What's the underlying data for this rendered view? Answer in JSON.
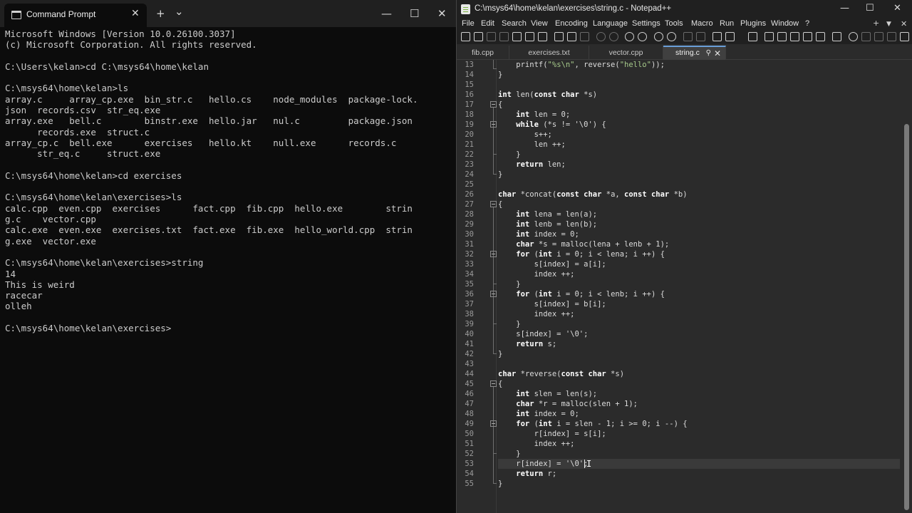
{
  "cmd": {
    "tab_title": "Command Prompt",
    "tab_close": "✕",
    "new_tab": "+",
    "dropdown": "⌄",
    "minimize": "—",
    "maximize": "☐",
    "close": "✕",
    "output": "Microsoft Windows [Version 10.0.26100.3037]\n(c) Microsoft Corporation. All rights reserved.\n\nC:\\Users\\kelan>cd C:\\msys64\\home\\kelan\n\nC:\\msys64\\home\\kelan>ls\narray.c     array_cp.exe  bin_str.c   hello.cs    node_modules  package-lock.\njson  records.csv  str_eq.exe\narray.exe   bell.c        binstr.exe  hello.jar   nul.c         package.json\n      records.exe  struct.c\narray_cp.c  bell.exe      exercises   hello.kt    null.exe      records.c\n      str_eq.c     struct.exe\n\nC:\\msys64\\home\\kelan>cd exercises\n\nC:\\msys64\\home\\kelan\\exercises>ls\ncalc.cpp  even.cpp  exercises      fact.cpp  fib.cpp  hello.exe        strin\ng.c    vector.cpp\ncalc.exe  even.exe  exercises.txt  fact.exe  fib.exe  hello_world.cpp  strin\ng.exe  vector.exe\n\nC:\\msys64\\home\\kelan\\exercises>string\n14\nThis is weird\nracecar\nolleh\n\nC:\\msys64\\home\\kelan\\exercises>"
  },
  "npp": {
    "title": "C:\\msys64\\home\\kelan\\exercises\\string.c - Notepad++",
    "window_controls": {
      "minimize": "—",
      "maximize": "☐",
      "close": "✕"
    },
    "menu": [
      "File",
      "Edit",
      "Search",
      "View",
      "Encoding",
      "Language",
      "Settings",
      "Tools",
      "Macro",
      "Run",
      "Plugins",
      "Window",
      "?"
    ],
    "menu_right": {
      "plus": "+",
      "dropdown": "▼",
      "close": "✕"
    },
    "tabs": [
      {
        "label": "fib.cpp"
      },
      {
        "label": "exercises.txt"
      },
      {
        "label": "vector.cpp"
      },
      {
        "label": "string.c",
        "pin": "⚲",
        "close": "✕"
      }
    ],
    "line_numbers": [
      "13",
      "14",
      "15",
      "16",
      "17",
      "18",
      "19",
      "20",
      "21",
      "22",
      "23",
      "24",
      "25",
      "26",
      "27",
      "28",
      "29",
      "30",
      "31",
      "32",
      "33",
      "34",
      "35",
      "36",
      "37",
      "38",
      "39",
      "40",
      "41",
      "42",
      "43",
      "44",
      "45",
      "46",
      "47",
      "48",
      "49",
      "50",
      "51",
      "52",
      "53",
      "54",
      "55"
    ],
    "code": {
      "l13a": "    printf(",
      "l13b": "\"%s\\n\"",
      "l13c": ", reverse(",
      "l13d": "\"hello\"",
      "l13e": "));",
      "l14": "}",
      "l16a": "int",
      "l16b": " len(",
      "l16c": "const char",
      "l16d": " *s)",
      "l17": "{",
      "l18a": "    int",
      "l18b": " len = 0;",
      "l19a": "    while",
      "l19b": " (*s != '\\0') {",
      "l20": "        s++;",
      "l21": "        len ++;",
      "l22": "    }",
      "l23a": "    return",
      "l23b": " len;",
      "l24": "}",
      "l26a": "char",
      "l26b": " *concat(",
      "l26c": "const char",
      "l26d": " *a, ",
      "l26e": "const char",
      "l26f": " *b)",
      "l27": "{",
      "l28a": "    int",
      "l28b": " lena = len(a);",
      "l29a": "    int",
      "l29b": " lenb = len(b);",
      "l30a": "    int",
      "l30b": " index = 0;",
      "l31a": "    char",
      "l31b": " *s = malloc(lena + lenb + 1);",
      "l32a": "    for",
      "l32b": " (",
      "l32c": "int",
      "l32d": " i = 0; i < lena; i ++) {",
      "l33": "        s[index] = a[i];",
      "l34": "        index ++;",
      "l35": "    }",
      "l36a": "    for",
      "l36b": " (",
      "l36c": "int",
      "l36d": " i = 0; i < lenb; i ++) {",
      "l37": "        s[index] = b[i];",
      "l38": "        index ++;",
      "l39": "    }",
      "l40": "    s[index] = '\\0';",
      "l41a": "    return",
      "l41b": " s;",
      "l42": "}",
      "l44a": "char",
      "l44b": " *reverse(",
      "l44c": "const char",
      "l44d": " *s)",
      "l45": "{",
      "l46a": "    int",
      "l46b": " slen = len(s);",
      "l47a": "    char",
      "l47b": " *r = malloc(slen + 1);",
      "l48a": "    int",
      "l48b": " index = 0;",
      "l49a": "    for",
      "l49b": " (",
      "l49c": "int",
      "l49d": " i = slen - 1; i >= 0; i --) {",
      "l50": "        r[index] = s[i];",
      "l51": "        index ++;",
      "l52": "    }",
      "l53": "    r[index] = '\\0';",
      "l54a": "    return",
      "l54b": " r;",
      "l55": "}"
    }
  }
}
